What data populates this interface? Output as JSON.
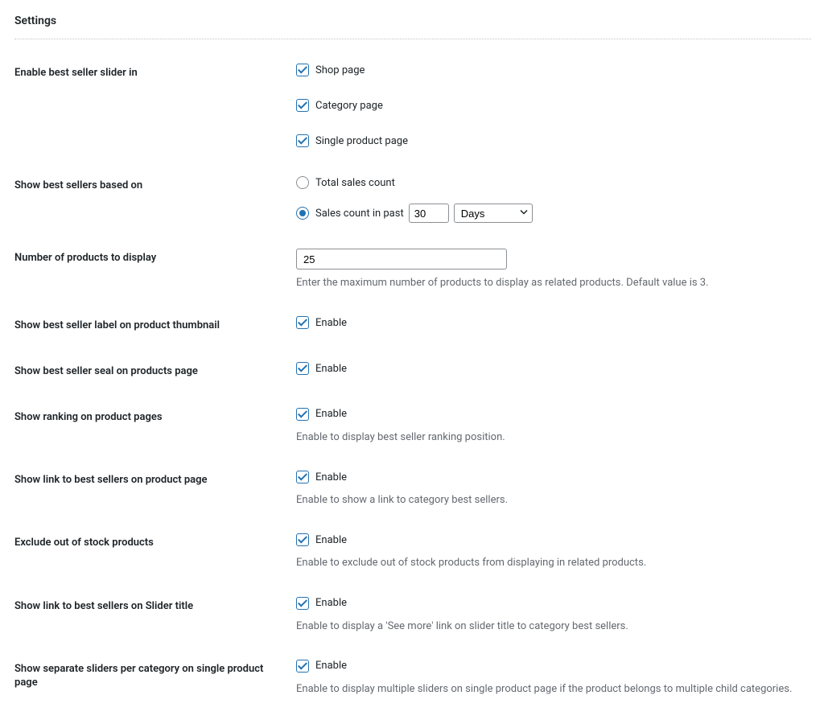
{
  "section": {
    "title": "Settings"
  },
  "rows": {
    "enable_slider": {
      "label": "Enable best seller slider in",
      "options": {
        "shop": {
          "label": "Shop page",
          "checked": true
        },
        "category": {
          "label": "Category page",
          "checked": true
        },
        "single": {
          "label": "Single product page",
          "checked": true
        }
      }
    },
    "based_on": {
      "label": "Show best sellers based on",
      "options": {
        "total": {
          "label": "Total sales count",
          "selected": false
        },
        "past": {
          "label": "Sales count in past",
          "selected": true,
          "days_value": "30",
          "unit_selected": "Days"
        }
      }
    },
    "num_products": {
      "label": "Number of products to display",
      "value": "25",
      "description": "Enter the maximum number of products to display as related products. Default value is 3."
    },
    "label_thumb": {
      "label": "Show best seller label on product thumbnail",
      "enable_label": "Enable",
      "checked": true
    },
    "seal_page": {
      "label": "Show best seller seal on products page",
      "enable_label": "Enable",
      "checked": true
    },
    "ranking": {
      "label": "Show ranking on product pages",
      "enable_label": "Enable",
      "checked": true,
      "description": "Enable to display best seller ranking position."
    },
    "link_product": {
      "label": "Show link to best sellers on product page",
      "enable_label": "Enable",
      "checked": true,
      "description": "Enable to show a link to category best sellers."
    },
    "exclude_oos": {
      "label": "Exclude out of stock products",
      "enable_label": "Enable",
      "checked": true,
      "description": "Enable to exclude out of stock products from displaying in related products."
    },
    "link_slider": {
      "label": "Show link to best sellers on Slider title",
      "enable_label": "Enable",
      "checked": true,
      "description": "Enable to display a 'See more' link on slider title to category best sellers."
    },
    "separate_sliders": {
      "label": "Show separate sliders per category on single product page",
      "enable_label": "Enable",
      "checked": true,
      "description": "Enable to display multiple sliders on single product page if the product belongs to multiple child categories."
    }
  }
}
